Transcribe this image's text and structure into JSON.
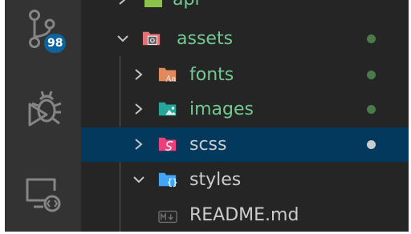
{
  "activity_bar": {
    "source_control": {
      "icon": "source-control-icon",
      "badge": "98"
    },
    "debug": {
      "icon": "debug-icon"
    },
    "remote_explorer": {
      "icon": "remote-explorer-icon"
    }
  },
  "explorer": {
    "items": [
      {
        "label": "api",
        "icon": "folder-api-icon",
        "expanded": false,
        "color": "#73c991"
      },
      {
        "label": "assets",
        "icon": "folder-assets-icon",
        "expanded": true,
        "color": "#73c991",
        "status_dot": "#4b7a4b"
      },
      {
        "label": "fonts",
        "icon": "folder-fonts-icon",
        "expanded": false,
        "color": "#73c991",
        "status_dot": "#4b7a4b"
      },
      {
        "label": "images",
        "icon": "folder-images-icon",
        "expanded": false,
        "color": "#73c991",
        "status_dot": "#4b7a4b"
      },
      {
        "label": "scss",
        "icon": "folder-scss-icon",
        "expanded": false,
        "selected": true,
        "color": "#cccccc",
        "status_dot": "#cccccc"
      },
      {
        "label": "styles",
        "icon": "folder-styles-icon",
        "expanded": true,
        "color": "#cccccc"
      },
      {
        "label": "README.md",
        "icon": "markdown-file-icon",
        "color": "#cccccc"
      }
    ]
  },
  "colors": {
    "activity_bar_bg": "#333333",
    "sidebar_bg": "#252526",
    "selection_bg": "#04395e",
    "badge_bg": "#0e639c",
    "git_added": "#73c991"
  }
}
